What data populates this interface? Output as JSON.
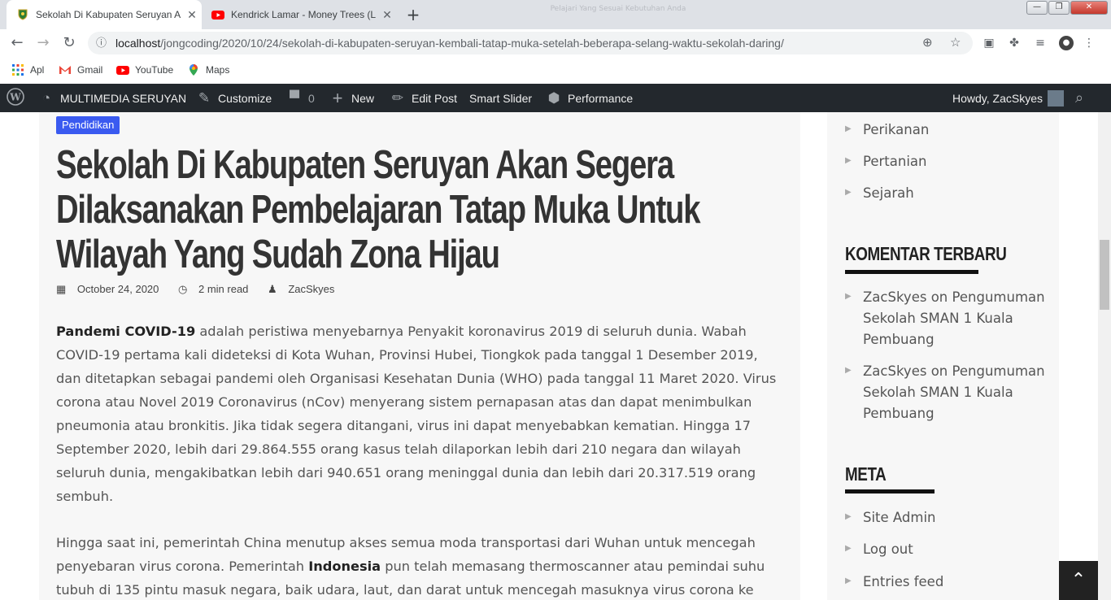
{
  "browser": {
    "window_title": "Pelajari Yang Sesuai Kebutuhan Anda",
    "tabs": [
      {
        "title": "Sekolah Di Kabupaten Seruyan A",
        "active": true
      },
      {
        "title": "Kendrick Lamar - Money Trees (L",
        "active": false
      }
    ],
    "url_host": "localhost",
    "url_path": "/jongcoding/2020/10/24/sekolah-di-kabupaten-seruyan-kembali-tatap-muka-setelah-beberapa-selang-waktu-sekolah-daring/",
    "bookmarks": [
      {
        "label": "Apl",
        "icon": "apps-grid-icon"
      },
      {
        "label": "Gmail",
        "icon": "gmail-icon"
      },
      {
        "label": "YouTube",
        "icon": "youtube-icon"
      },
      {
        "label": "Maps",
        "icon": "maps-pin-icon"
      }
    ]
  },
  "adminbar": {
    "site_name": "MULTIMEDIA SERUYAN",
    "customize": "Customize",
    "comments_count": "0",
    "new": "New",
    "edit_post": "Edit Post",
    "smart_slider": "Smart Slider",
    "performance": "Performance",
    "howdy": "Howdy, ZacSkyes"
  },
  "post": {
    "category": "Pendidikan",
    "title": "Sekolah Di Kabupaten Seruyan Akan Segera Dilaksanakan Pembelajaran Tatap Muka Untuk Wilayah Yang Sudah Zona Hijau",
    "date": "October 24, 2020",
    "read_time": "2 min read",
    "author": "ZacSkyes",
    "p1_bold": "Pandemi COVID-19",
    "p1_rest": " adalah peristiwa menyebarnya Penyakit koronavirus 2019 di seluruh dunia. Wabah COVID-19 pertama kali dideteksi di Kota Wuhan, Provinsi Hubei, Tiongkok pada tanggal 1 Desember 2019, dan ditetapkan sebagai pandemi oleh Organisasi Kesehatan Dunia (WHO) pada tanggal 11 Maret 2020. Virus corona atau Novel 2019 Coronavirus (nCov) menyerang sistem pernapasan atas dan dapat menimbulkan pneumonia atau bronkitis. Jika tidak segera ditangani, virus ini dapat menyebabkan kematian. Hingga 17 September 2020, lebih dari 29.864.555 orang kasus telah dilaporkan lebih dari 210 negara dan wilayah seluruh dunia, mengakibatkan lebih dari 940.651 orang meninggal dunia dan lebih dari 20.317.519 orang sembuh.",
    "p2_a": "Hingga saat ini, pemerintah China menutup akses semua moda transportasi dari Wuhan untuk mencegah penyebaran virus corona. Pemerintah ",
    "p2_bold": "Indonesia",
    "p2_b": " pun telah memasang thermoscanner atau pemindai suhu tubuh di 135 pintu masuk negara, baik udara, laut, dan darat untuk mencegah masuknya virus corona ke"
  },
  "sidebar": {
    "categories": [
      "Perikanan",
      "Pertanian",
      "Sejarah"
    ],
    "recent_comments_title": "KOMENTAR TERBARU",
    "comments": [
      {
        "author": "ZacSkyes",
        "on": "on",
        "post": "Pengumuman Sekolah SMAN 1 Kuala Pembuang"
      },
      {
        "author": "ZacSkyes",
        "on": "on",
        "post": "Pengumuman Sekolah SMAN 1 Kuala Pembuang"
      }
    ],
    "meta_title": "META",
    "meta_links": [
      "Site Admin",
      "Log out",
      "Entries feed"
    ]
  }
}
